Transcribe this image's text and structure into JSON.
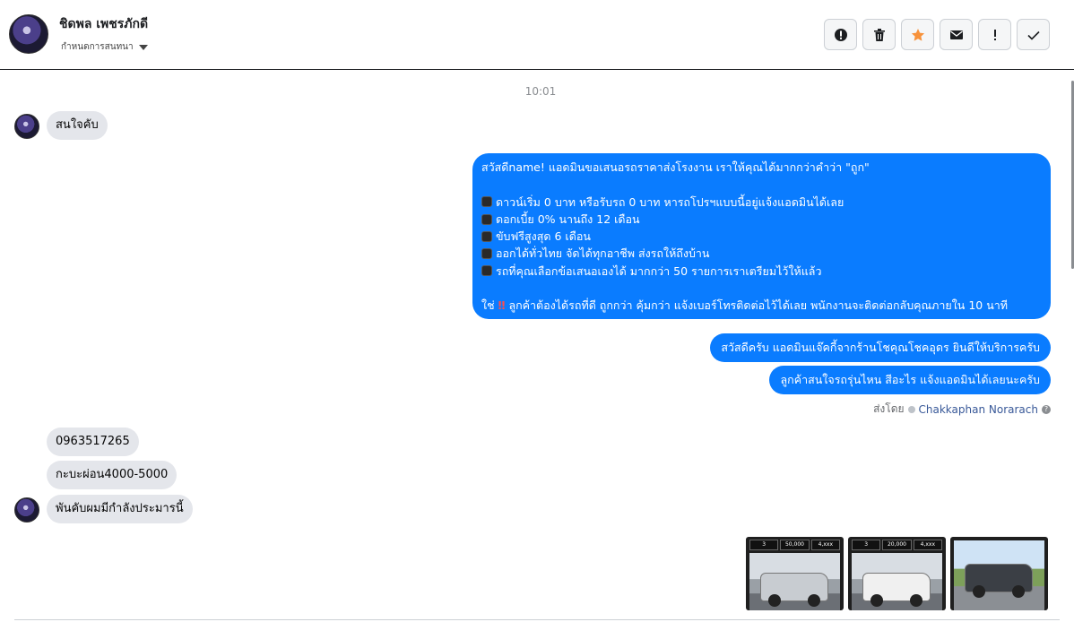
{
  "header": {
    "name": "ชิดพล เพชรภักดี",
    "sub_label": "กำหนดการสนทนา",
    "toolbar": [
      "alert-circle",
      "trash",
      "star",
      "envelope",
      "exclamation",
      "check"
    ]
  },
  "colors": {
    "outgoing": "#0a7cff",
    "incoming": "#e4e6eb",
    "star": "#f7923b"
  },
  "conversation": {
    "time": "10:01",
    "msg1": "สนใจคับ",
    "big": {
      "l1": "สวัสดีname! แอดมินขอเสนอรถราคาส่งโรงงาน เราให้คุณได้มากกว่าคำว่า \"ถูก\"",
      "l2": "ดาวน์เริ่ม 0 บาท หรือรับรถ 0 บาท หารถโปรฯแบบนี้อยู่แจ้งแอดมินได้เลย",
      "l3": "ดอกเบี้ย 0% นานถึง 12 เดือน",
      "l4": "ขับฟรีสูงสุด 6 เดือน",
      "l5": "ออกได้ทั่วไทย จัดได้ทุกอาชีพ ส่งรถให้ถึงบ้าน",
      "l6": "รถที่คุณเลือกข้อเสนอเองได้ มากกว่า 50 รายการเราเตรียมไว้ให้แล้ว",
      "l7a": "ใช่",
      "l7b": "ลูกค้าต้องได้รถที่ดี ถูกกว่า คุ้มกว่า แจ้งเบอร์โทรติดต่อไว้ได้เลย พนักงานจะติดต่อกลับคุณภายใน 10 นาที"
    },
    "out2": "สวัสดีครับ แอดมินแจ๊คกี้จากร้านโชคุณโชคอุดร ยินดีให้บริการครับ",
    "out3": "ลูกค้าสนใจรถรุ่นไหน สีอะไร แจ้งแอดมินได้เลยนะครับ",
    "sent_prefix": "ส่งโดย",
    "sent_by": "Chakkaphan Norarach",
    "sent_help": "?",
    "in_phone": "0963517265",
    "in_budget": "กะบะผ่อน4000-5000",
    "in_last": "พันคับผมมีกำลังประมารนี้",
    "thumbs": [
      {
        "a": "3",
        "b": "50,000",
        "c": "4,xxx"
      },
      {
        "a": "3",
        "b": "20,000",
        "c": "4,xxx"
      },
      {
        "a": "",
        "b": "",
        "c": ""
      }
    ]
  }
}
